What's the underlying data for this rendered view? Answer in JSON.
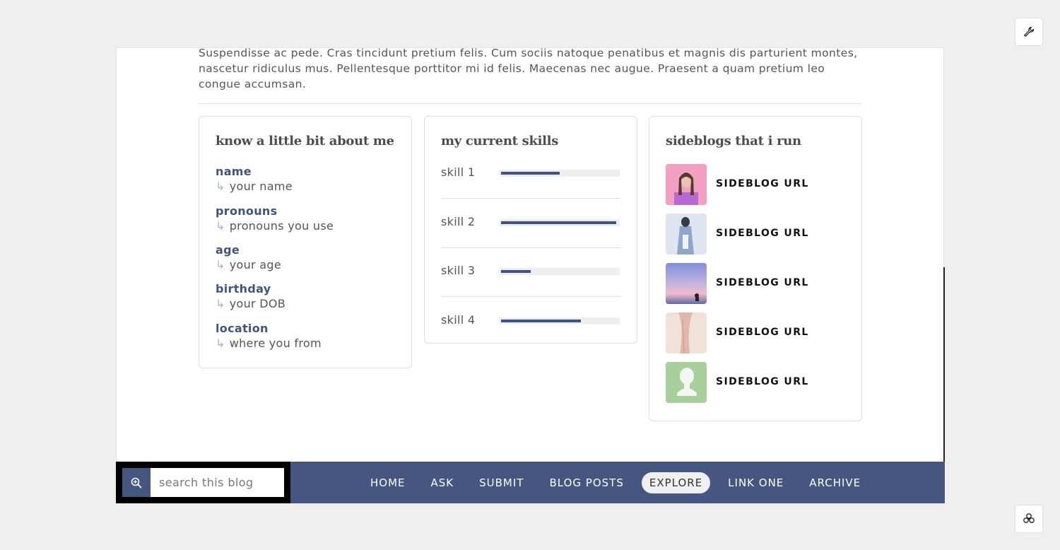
{
  "intro_text": "Suspendisse ac pede. Cras tincidunt pretium felis. Cum sociis natoque penatibus et magnis dis parturient montes, nascetur ridiculus mus. Pellentesque porttitor mi id felis. Maecenas nec augue. Praesent a quam pretium leo congue accumsan.",
  "about": {
    "title": "know a little bit about me",
    "arrow": "↳",
    "fields": [
      {
        "label": "name",
        "value": "your name"
      },
      {
        "label": "pronouns",
        "value": "pronouns you use"
      },
      {
        "label": "age",
        "value": "your age"
      },
      {
        "label": "birthday",
        "value": "your DOB"
      },
      {
        "label": "location",
        "value": "where you from"
      }
    ]
  },
  "skills": {
    "title": "my current skills",
    "items": [
      {
        "name": "skill 1",
        "level": 0.5
      },
      {
        "name": "skill 2",
        "level": 0.98
      },
      {
        "name": "skill 3",
        "level": 0.25
      },
      {
        "name": "skill 4",
        "level": 0.68
      }
    ]
  },
  "sideblogs": {
    "title": "sideblogs that i run",
    "items": [
      {
        "url": "SIDEBLOG URL",
        "thumb_color": "#f29fc2"
      },
      {
        "url": "SIDEBLOG URL",
        "thumb_color": "#c9d3e8"
      },
      {
        "url": "SIDEBLOG URL",
        "thumb_color": "#8c97d6"
      },
      {
        "url": "SIDEBLOG URL",
        "thumb_color": "#ecd5cb"
      },
      {
        "url": "SIDEBLOG URL",
        "thumb_color": "#a9cf9a"
      }
    ]
  },
  "search": {
    "placeholder": "search this blog",
    "icon": "zoom-in-icon"
  },
  "nav": {
    "links": [
      "HOME",
      "ASK",
      "SUBMIT",
      "BLOG POSTS",
      "EXPLORE",
      "LINK ONE",
      "ARCHIVE"
    ],
    "active": "EXPLORE"
  },
  "corner_buttons": {
    "top": "wrench-icon",
    "bottom": "settings-icon"
  },
  "colors": {
    "accent": "#455780",
    "background": "#efefef"
  }
}
